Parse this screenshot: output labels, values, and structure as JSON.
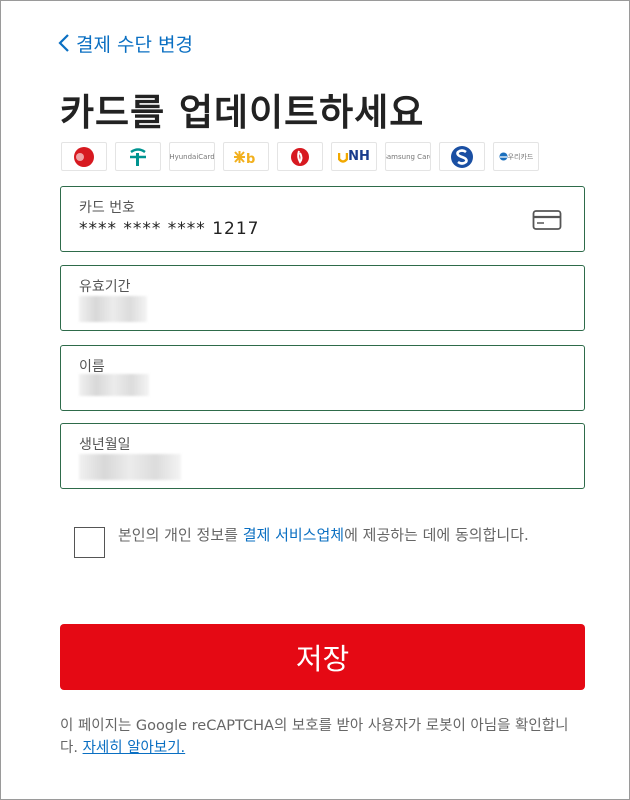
{
  "nav": {
    "back_label": "결제 수단 변경"
  },
  "page": {
    "title": "카드를 업데이트하세요"
  },
  "card_logos": [
    {
      "name": "bc-card",
      "text": "",
      "color": "#d71920"
    },
    {
      "name": "hana-card",
      "text": "",
      "color": "#009490"
    },
    {
      "name": "hyundai-card",
      "text": "HyundaiCard",
      "color": "#777777"
    },
    {
      "name": "kb-card",
      "text": "",
      "color": "#f2b01e"
    },
    {
      "name": "lotte-card",
      "text": "",
      "color": "#d71920"
    },
    {
      "name": "nh-card",
      "text": "NH",
      "color": "#1a3c8c"
    },
    {
      "name": "samsung-card",
      "text": "Samsung Card",
      "color": "#777777"
    },
    {
      "name": "shinhan-card",
      "text": "",
      "color": "#1a4fa3"
    },
    {
      "name": "woori-card",
      "text": "우리카드",
      "color": "#1a6fbd"
    }
  ],
  "form": {
    "card_number": {
      "label": "카드 번호",
      "value": "**** **** **** 1217"
    },
    "expiry": {
      "label": "유효기간",
      "value": ""
    },
    "name": {
      "label": "이름",
      "value": ""
    },
    "birthdate": {
      "label": "생년월일",
      "value": ""
    }
  },
  "consent": {
    "text_before": "본인의 개인 정보를 ",
    "link": "결제 서비스업체",
    "text_after": "에 제공하는 데에 동의합니다."
  },
  "actions": {
    "save_label": "저장"
  },
  "recaptcha": {
    "text": "이 페이지는 Google reCAPTCHA의 보호를 받아 사용자가 로봇이 아님을 확인합니다. ",
    "link": "자세히 알아보기."
  },
  "colors": {
    "accent": "#e50914",
    "link": "#0a6fc2",
    "field_border": "#2e6b4a"
  }
}
